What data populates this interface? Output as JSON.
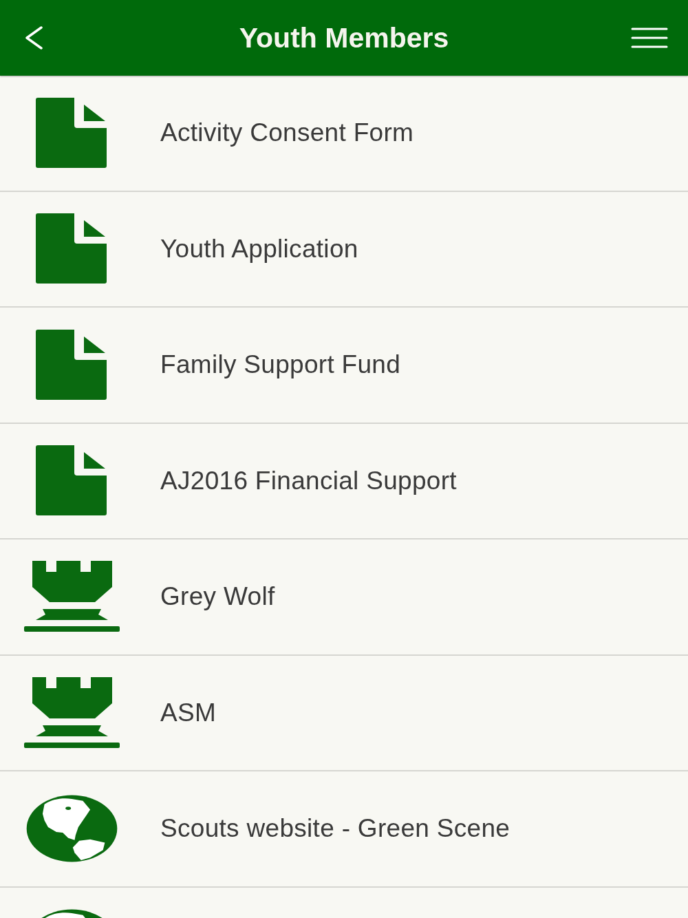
{
  "header": {
    "title": "Youth Members"
  },
  "items": [
    {
      "kind": "document",
      "label": "Activity Consent Form"
    },
    {
      "kind": "document",
      "label": "Youth Application"
    },
    {
      "kind": "document",
      "label": "Family Support Fund"
    },
    {
      "kind": "document",
      "label": "AJ2016 Financial Support"
    },
    {
      "kind": "castle",
      "label": "Grey Wolf"
    },
    {
      "kind": "castle",
      "label": "ASM"
    },
    {
      "kind": "web",
      "label": "Scouts website - Green Scene"
    },
    {
      "kind": "web"
    }
  ]
}
